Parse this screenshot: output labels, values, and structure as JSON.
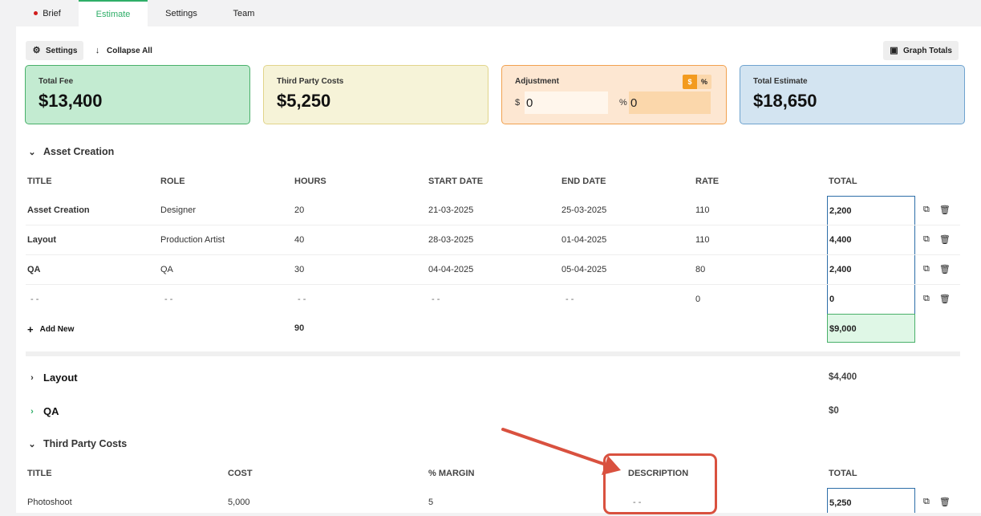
{
  "tabs": [
    {
      "label": "Brief"
    },
    {
      "label": "Estimate"
    },
    {
      "label": "Settings"
    },
    {
      "label": "Team"
    }
  ],
  "toolbar": {
    "settings_label": "Settings",
    "collapse_label": "Collapse All",
    "graph_label": "Graph Totals"
  },
  "cards": {
    "total_fee": {
      "label": "Total Fee",
      "value": "$13,400"
    },
    "third_party": {
      "label": "Third Party Costs",
      "value": "$5,250"
    },
    "adjustment": {
      "label": "Adjustment",
      "toggle_dollar": "$",
      "toggle_percent": "%",
      "dollar_prefix": "$",
      "dollar_value": "0",
      "percent_prefix": "%",
      "percent_value": "0"
    },
    "total_estimate": {
      "label": "Total Estimate",
      "value": "$18,650"
    }
  },
  "asset_creation": {
    "title": "Asset Creation",
    "headers": [
      "TITLE",
      "ROLE",
      "HOURS",
      "START DATE",
      "END DATE",
      "RATE",
      "TOTAL"
    ],
    "rows": [
      {
        "title": "Asset Creation",
        "role": "Designer",
        "hours": "20",
        "start": "21-03-2025",
        "end": "25-03-2025",
        "rate": "110",
        "total": "2,200"
      },
      {
        "title": "Layout",
        "role": "Production Artist",
        "hours": "40",
        "start": "28-03-2025",
        "end": "01-04-2025",
        "rate": "110",
        "total": "4,400"
      },
      {
        "title": "QA",
        "role": "QA",
        "hours": "30",
        "start": "04-04-2025",
        "end": "05-04-2025",
        "rate": "80",
        "total": "2,400"
      },
      {
        "title": "- -",
        "role": "- -",
        "hours": "- -",
        "start": "- -",
        "end": "- -",
        "rate": "0",
        "total": "0"
      }
    ],
    "add_new": "Add New",
    "hours_total": "90",
    "sum_total": "$9,000"
  },
  "layout_section": {
    "title": "Layout",
    "total": "$4,400"
  },
  "qa_section": {
    "title": "QA",
    "total": "$0"
  },
  "third_party_section": {
    "title": "Third Party Costs",
    "headers": [
      "TITLE",
      "COST",
      "% MARGIN",
      "DESCRIPTION",
      "TOTAL"
    ],
    "rows": [
      {
        "title": "Photoshoot",
        "cost": "5,000",
        "margin": "5",
        "description": "- -",
        "total": "5,250"
      }
    ]
  },
  "colors": {
    "accent_green": "#2fae68",
    "annotation_red": "#d9513f",
    "adjustment_orange": "#f39b1f"
  }
}
